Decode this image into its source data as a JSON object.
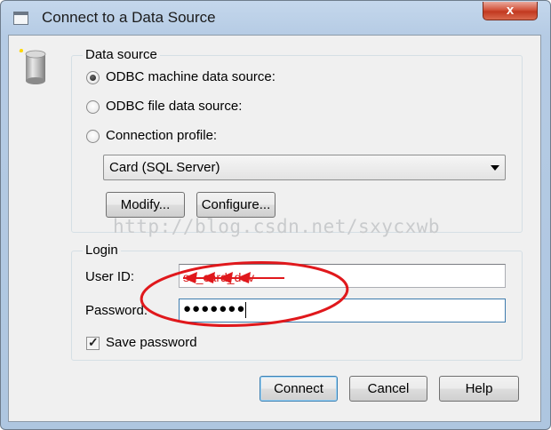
{
  "window": {
    "title": "Connect to a Data Source",
    "close_glyph": "x"
  },
  "data_source": {
    "group_label": "Data source",
    "options": [
      {
        "label": "ODBC machine data source:",
        "selected": true
      },
      {
        "label": "ODBC file data source:",
        "selected": false
      },
      {
        "label": "Connection profile:",
        "selected": false
      }
    ],
    "profile_value": "Card (SQL Server)",
    "modify_label": "Modify...",
    "configure_label": "Configure..."
  },
  "watermark": "http://blog.csdn.net/sxycxwb",
  "login": {
    "group_label": "Login",
    "user_id_label": "User ID:",
    "user_id_value": "sa_card_dev",
    "password_label": "Password:",
    "password_mask": "●●●●●●●",
    "save_password_label": "Save password",
    "save_password_checked": true
  },
  "buttons": {
    "connect": "Connect",
    "cancel": "Cancel",
    "help": "Help"
  },
  "colors": {
    "annotation_red": "#e0181c",
    "title_bar": "#b5cbe4",
    "close_button": "#c94a30"
  },
  "icons": {
    "app": "window-icon",
    "database": "database-icon",
    "close": "close-icon"
  }
}
